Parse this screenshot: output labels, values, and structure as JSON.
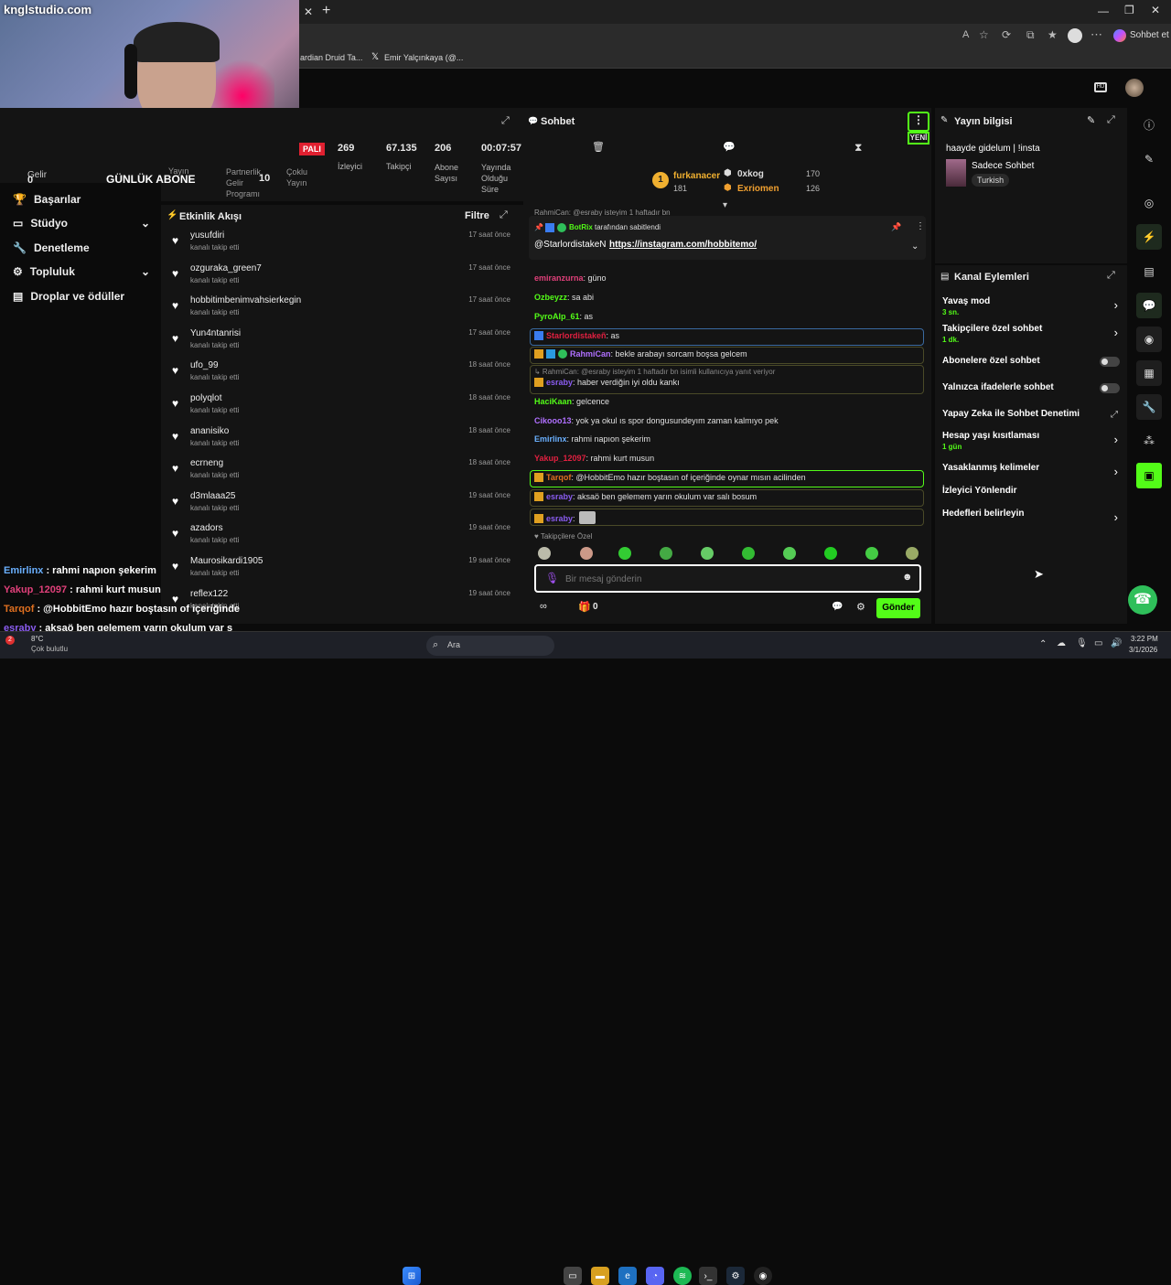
{
  "browser": {
    "tab_title": "knglstudio.com",
    "copilot_label": "Sohbet et",
    "bookmarks": [
      "ardian Druid Ta...",
      "Emir Yalçınkaya (@..."
    ]
  },
  "left": {
    "live_badge": "PALI",
    "stats": [
      {
        "value": "269",
        "label": "İzleyici"
      },
      {
        "value": "67.135",
        "label": "Takipçi"
      },
      {
        "value": "206",
        "label": "Abone Sayısı"
      },
      {
        "value": "00:07:57",
        "label": "Yayında Olduğu Süre"
      }
    ],
    "overlay_labels": [
      "Yayın",
      "Partnerlik Gelir Programı",
      "Çoklu Yayın"
    ],
    "gelir": "Gelir",
    "gelir_val": "0",
    "daily_sub_label": "GÜNLÜK ABONE",
    "daily_sub_val": "10",
    "nav": [
      "Başarılar",
      "Stüdyo",
      "Denetleme",
      "Topluluk",
      "Droplar ve ödüller"
    ]
  },
  "feed": {
    "title": "Etkinlik Akışı",
    "filter": "Filtre",
    "items": [
      {
        "name": "yusufdiri",
        "action": "kanalı takip etti",
        "time": "17 saat önce"
      },
      {
        "name": "ozguraka_green7",
        "action": "kanalı takip etti",
        "time": "17 saat önce"
      },
      {
        "name": "hobbitimbenimvahsierkegin",
        "action": "kanalı takip etti",
        "time": "17 saat önce"
      },
      {
        "name": "Yun4ntanrisi",
        "action": "kanalı takip etti",
        "time": "17 saat önce"
      },
      {
        "name": "ufo_99",
        "action": "kanalı takip etti",
        "time": "18 saat önce"
      },
      {
        "name": "polyqlot",
        "action": "kanalı takip etti",
        "time": "18 saat önce"
      },
      {
        "name": "ananisiko",
        "action": "kanalı takip etti",
        "time": "18 saat önce"
      },
      {
        "name": "ecrneng",
        "action": "kanalı takip etti",
        "time": "18 saat önce"
      },
      {
        "name": "d3mlaaa25",
        "action": "kanalı takip etti",
        "time": "19 saat önce"
      },
      {
        "name": "azadors",
        "action": "kanalı takip etti",
        "time": "19 saat önce"
      },
      {
        "name": "Maurosikardi1905",
        "action": "kanalı takip etti",
        "time": "19 saat önce"
      },
      {
        "name": "reflex122",
        "action": "kanalı takip etti",
        "time": "19 saat önce"
      }
    ]
  },
  "overlay_chat": [
    {
      "user": "Emirlinx",
      "text": " : rahmi napıon şekerim",
      "color": "#6ab0ff"
    },
    {
      "user": "Yakup_12097",
      "text": " : rahmi kurt musun",
      "color": "#e0407a"
    },
    {
      "user": "Tarqof",
      "text": " : @HobbitEmo hazır boştasın of içeriğinde",
      "color": "#e07020"
    },
    {
      "user": "esraby",
      "text": " : aksaö ben gelemem yarın okulum var s",
      "color": "#8a5cf0"
    }
  ],
  "chat": {
    "title": "Sohbet",
    "new_label": "YENİ",
    "leaders": [
      {
        "rank": "1",
        "name": "furkanacer",
        "val": "181",
        "color": "#f0b030"
      },
      {
        "name": "0xkog",
        "val": "170",
        "color": "#ddd"
      },
      {
        "name": "Exriomen",
        "val": "126",
        "color": "#f0a030"
      }
    ],
    "pinned_by": "BotRix",
    "pinned_suffix": " tarafından sabitlendi",
    "pinned_user": "@StarlordistakeN",
    "pinned_link": "https://instagram.com/hobbitemo/",
    "pinned_peek": "RahmiCan: @esraby isteyim 1 haftadır bn",
    "messages": [
      {
        "user": "emiranzurna",
        "text": ": güno",
        "color": "#e0407a"
      },
      {
        "user": "Ozbeyzz",
        "text": ": sa abi",
        "color": "#53fc18"
      },
      {
        "user": "PyroAlp_61",
        "text": ": as",
        "color": "#53fc18"
      },
      {
        "user": "Starlordistakeñ",
        "text": ": as",
        "color": "#e02040"
      },
      {
        "user": "RahmiCan",
        "text": ": bekle arabayı sorcam boşsa gelcem",
        "color": "#b070ff"
      },
      {
        "reply": "RahmiCan: @esraby isteyim 1 haftadır bn isimli kullanıcıya yanıt veriyor",
        "user": "esraby",
        "text": ": haber verdiğin iyi oldu kankı",
        "color": "#8a5cf0"
      },
      {
        "user": "HaciKaan",
        "text": ": gelcence",
        "color": "#53fc18"
      },
      {
        "user": "Cikooo13",
        "text": ": yok ya okul ıs spor dongusundeyım zaman kalmıyo pek",
        "color": "#b070ff"
      },
      {
        "user": "Emirlinx",
        "text": ": rahmi napıon şekerim",
        "color": "#6ab0ff"
      },
      {
        "user": "Yakup_12097",
        "text": ": rahmi kurt musun",
        "color": "#e02040"
      },
      {
        "user": "Tarqof",
        "text": ": @HobbitEmo hazır boştasın of içeriğinde oynar mısın acilinden",
        "color": "#e07020"
      },
      {
        "user": "esraby",
        "text": ": aksaö ben gelemem yarın okulum var salı bosum",
        "color": "#8a5cf0"
      },
      {
        "user": "esraby",
        "text": ":",
        "color": "#8a5cf0"
      }
    ],
    "emote_section": "Takipçilere Özel",
    "input_placeholder": "Bir mesaj gönderin",
    "points": "0",
    "send_label": "Gönder"
  },
  "stream_info": {
    "title": "Yayın bilgisi",
    "stream_title": "haayde gidelum | !insta",
    "category": "Sadece Sohbet",
    "tag": "Turkish"
  },
  "channel_actions": {
    "title": "Kanal Eylemleri",
    "items": [
      {
        "label": "Yavaş mod",
        "sub": "3 sn.",
        "control": "arrow"
      },
      {
        "label": "Takipçilere özel sohbet",
        "sub": "1 dk.",
        "control": "arrow"
      },
      {
        "label": "Abonelere özel sohbet",
        "sub": "",
        "control": "toggle"
      },
      {
        "label": "Yalnızca ifadelerle sohbet",
        "sub": "",
        "control": "toggle"
      },
      {
        "label": "Yapay Zeka ile Sohbet Denetimi",
        "sub": "",
        "control": "external"
      },
      {
        "label": "Hesap yaşı kısıtlaması",
        "sub": "1 gün",
        "control": "arrow"
      },
      {
        "label": "Yasaklanmış kelimeler",
        "sub": "",
        "control": "arrow"
      },
      {
        "label": "İzleyici Yönlendir",
        "sub": "",
        "control": "none"
      },
      {
        "label": "Hedefleri belirleyin",
        "sub": "",
        "control": "arrow"
      }
    ]
  },
  "taskbar": {
    "weather_temp": "8°C",
    "weather_desc": "Çok bulutlu",
    "search": "Ara",
    "time": "3:22 PM",
    "date": "3/1/2026"
  },
  "colors": {
    "kick_green": "#53fc18"
  }
}
